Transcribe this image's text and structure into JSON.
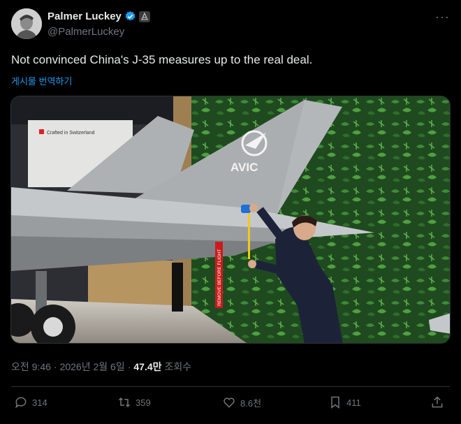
{
  "author": {
    "display_name": "Palmer Luckey",
    "handle": "@PalmerLuckey",
    "verified_icon": "verified-badge-icon",
    "affiliation_icon": "affiliate-badge-icon"
  },
  "tweet": {
    "text": "Not convinced China's J-35 measures up to the real deal.",
    "translate_label": "게시물 번역하기"
  },
  "media": {
    "image_signs": {
      "left_sign": "Crafted in Switzerland",
      "tail_logo": "AVIC",
      "remove_tag": "REMOVE BEFORE FLIGHT"
    }
  },
  "meta": {
    "time": "오전 9:46",
    "date": "2026년 2월 6일",
    "views": "47.4만",
    "views_label": "조회수",
    "separator": "·"
  },
  "actions": {
    "reply_count": "314",
    "repost_count": "359",
    "like_count": "8.6천",
    "bookmark_count": "411"
  },
  "colors": {
    "background": "#000000",
    "text": "#e7e9ea",
    "muted": "#71767b",
    "link": "#1d9bf0",
    "divider": "#2f3336"
  }
}
